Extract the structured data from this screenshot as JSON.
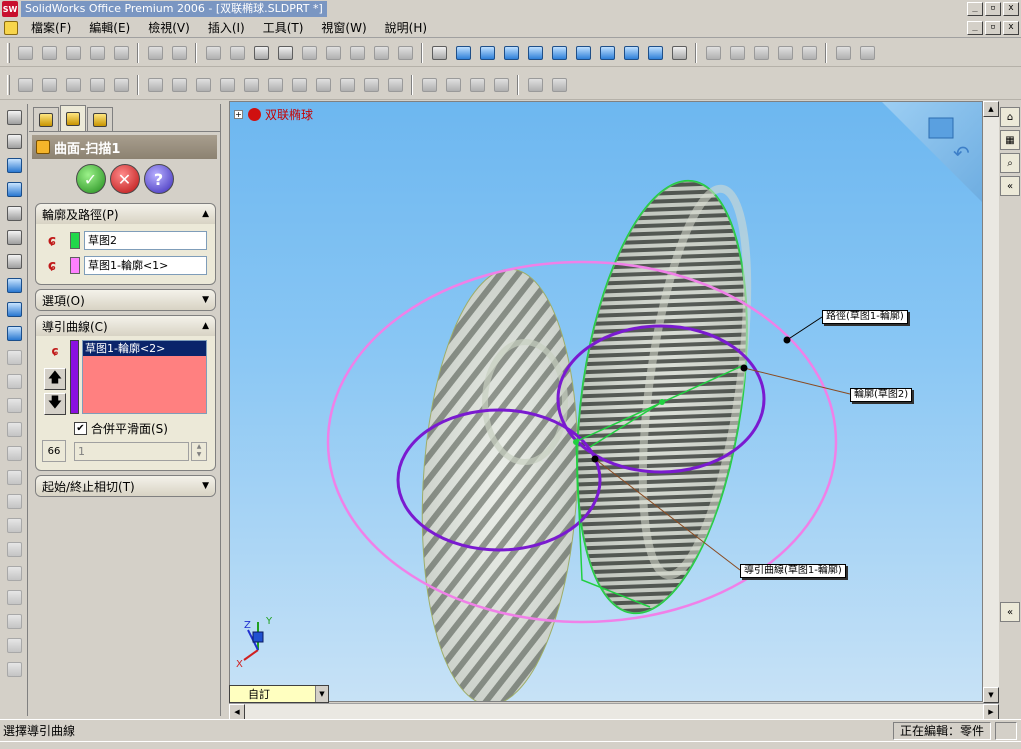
{
  "window": {
    "title": "SolidWorks Office Premium 2006 - [双联椭球.SLDPRT *]",
    "app_icon_text": "SW"
  },
  "menu": {
    "items": [
      "檔案(F)",
      "編輯(E)",
      "檢視(V)",
      "插入(I)",
      "工具(T)",
      "視窗(W)",
      "說明(H)"
    ]
  },
  "property_manager": {
    "title": "曲面-扫描1",
    "ok_label": "✓",
    "cancel_label": "✕",
    "help_label": "?",
    "profile_path": {
      "header": "輪廓及路徑(P)",
      "profile_value": "草图2",
      "profile_color": "#21d84a",
      "path_value": "草图1-輪廓<1>",
      "path_color": "#ff80ff"
    },
    "options": {
      "header": "選項(O)"
    },
    "guide_curves": {
      "header": "導引曲線(C)",
      "selected_item": "草图1-輪廓<2>",
      "bar_color": "#8a10e0",
      "list_color": "#ff8080",
      "merge_smooth_label": "合併平滑面(S)",
      "merge_smooth_checked": true,
      "spin_value": "1"
    },
    "tangency": {
      "header": "起始/終止相切(T)"
    }
  },
  "viewport": {
    "tree_item": "双联椭球",
    "callouts": {
      "path": "路徑(草图1-輪廓)",
      "profile": "輪廓(草图2)",
      "guide": "導引曲線(草图1-輪廓)"
    },
    "axis_labels": {
      "x": "X",
      "y": "Y",
      "z": "Z"
    },
    "view_combo": "自訂"
  },
  "status": {
    "message": "選擇導引曲線",
    "editing": "正在編輯：零件"
  },
  "colors": {
    "pink_path": "#f080e8",
    "purple_guide": "#7a1ad0",
    "green_profile": "#20d040"
  }
}
